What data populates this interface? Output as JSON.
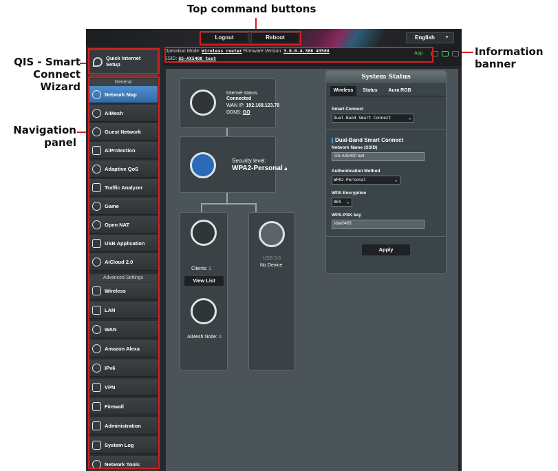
{
  "annotations": {
    "top_buttons": "Top command buttons",
    "info_banner_1": "Information",
    "info_banner_2": "banner",
    "qis_1": "QIS - Smart",
    "qis_2": "Connect",
    "qis_3": "Wizard",
    "nav_1": "Navigation",
    "nav_2": "panel"
  },
  "topbar": {
    "logout": "Logout",
    "reboot": "Reboot",
    "language": "English"
  },
  "banner": {
    "mode_label": "Operation Mode:",
    "mode_value": "Wireless router",
    "fw_label": "Firmware Version:",
    "fw_value": "3.0.0.4.386_43588",
    "ssid_label": "SSID:",
    "ssid_value": "GS-AX5400 test",
    "app": "App"
  },
  "sidebar": {
    "qis_label": "Quick Internet Setup",
    "general_header": "General",
    "general": [
      "Network Map",
      "AiMesh",
      "Guest Network",
      "AiProtection",
      "Adaptive QoS",
      "Traffic Analyzer",
      "Game",
      "Open NAT",
      "USB Application",
      "AiCloud 2.0"
    ],
    "advanced_header": "Advanced Settings",
    "advanced": [
      "Wireless",
      "LAN",
      "WAN",
      "Amazon Alexa",
      "IPv6",
      "VPN",
      "Firewall",
      "Administration",
      "System Log",
      "Network Tools"
    ]
  },
  "map": {
    "internet_status_label": "Internet status:",
    "internet_status": "Connected",
    "wan_ip_label": "WAN IP:",
    "wan_ip": "192.168.123.78",
    "ddns_label": "DDNS:",
    "ddns": "GO",
    "security_label": "Security level:",
    "security_value": "WPA2-Personal",
    "clients_label": "Clients:",
    "clients_count": "1",
    "view_list": "View List",
    "usb_label": "USB 3.0",
    "usb_status": "No Device",
    "aimesh_label": "AiMesh Node:",
    "aimesh_count": "0"
  },
  "system_status": {
    "title": "System Status",
    "tabs": [
      "Wireless",
      "Status",
      "Aura RGB"
    ],
    "smart_connect_label": "Smart Connect",
    "smart_connect_value": "Dual-Band Smart Connect",
    "section_title": "Dual-Band Smart Connect",
    "ssid_label": "Network Name (SSID)",
    "ssid_value": "GS-AX5400 test",
    "auth_label": "Authentication Method",
    "auth_value": "WPA2-Personal",
    "enc_label": "WPA Encryption",
    "enc_value": "AES",
    "psk_label": "WPA-PSK key",
    "psk_value": "idan0405",
    "apply": "Apply"
  },
  "colors": {
    "annotation_line": "#d42020",
    "active_nav": "#3f7dc0",
    "connected_green": "#5fd35f"
  }
}
